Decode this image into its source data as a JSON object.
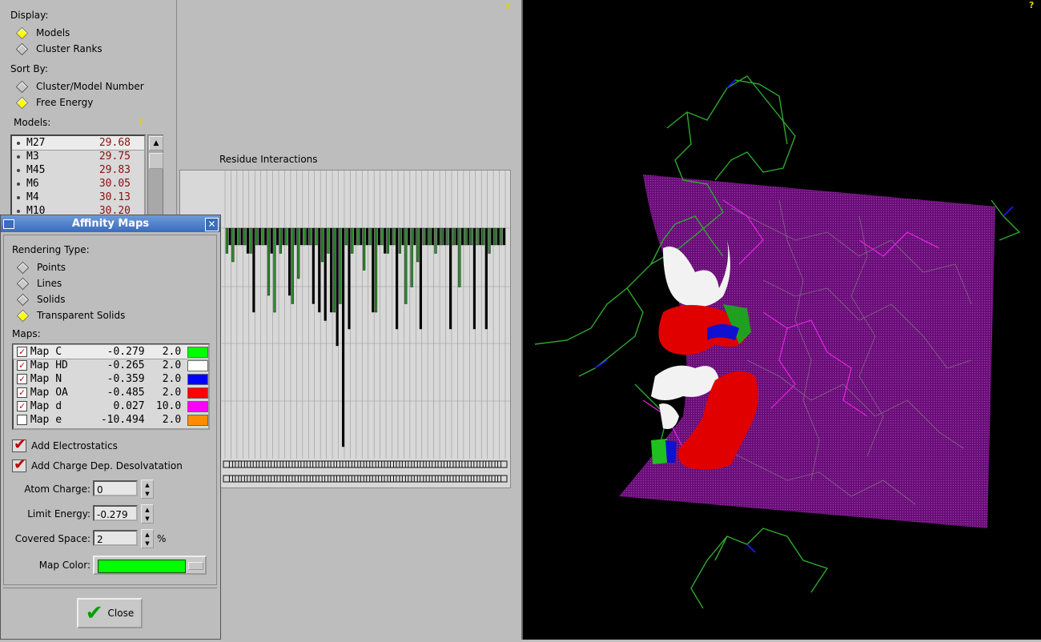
{
  "left_panel": {
    "display_label": "Display:",
    "display_options": [
      {
        "label": "Models",
        "selected": true
      },
      {
        "label": "Cluster Ranks",
        "selected": false
      }
    ],
    "sort_label": "Sort By:",
    "sort_options": [
      {
        "label": "Cluster/Model Number",
        "selected": false
      },
      {
        "label": "Free Energy",
        "selected": true
      }
    ],
    "models_label": "Models:",
    "help": "?",
    "models": [
      {
        "name": "M27",
        "value": "29.68"
      },
      {
        "name": "M3",
        "value": "29.75"
      },
      {
        "name": "M45",
        "value": "29.83"
      },
      {
        "name": "M6",
        "value": "30.05"
      },
      {
        "name": "M4",
        "value": "30.13"
      },
      {
        "name": "M10",
        "value": "30.20"
      }
    ]
  },
  "chart_panel": {
    "help": "?",
    "chart_data": {
      "type": "bar",
      "title": "Residue Interactions",
      "note": "Per-residue interaction bars hanging down from a common baseline; green and black series. Residue tick labels are overlapping and illegible.",
      "series": [
        {
          "color": "#2e8b2e",
          "values": [
            3,
            4,
            2,
            2,
            3,
            2,
            2,
            8,
            10,
            3,
            2,
            9,
            6,
            2,
            2,
            2,
            4,
            3,
            10,
            9,
            2,
            3,
            2,
            5,
            2,
            10,
            2,
            3,
            2,
            3,
            9,
            7,
            4,
            2,
            2,
            3,
            2,
            2,
            2,
            7,
            2,
            2,
            2,
            2,
            3,
            2,
            2
          ]
        },
        {
          "color": "#000000",
          "values": [
            2,
            2,
            2,
            3,
            10,
            2,
            2,
            3,
            2,
            2,
            8,
            2,
            2,
            2,
            9,
            10,
            11,
            10,
            14,
            26,
            12,
            2,
            2,
            2,
            10,
            2,
            3,
            2,
            12,
            2,
            2,
            2,
            12,
            2,
            2,
            2,
            2,
            12,
            2,
            2,
            2,
            12,
            2,
            12,
            2,
            2,
            2
          ]
        }
      ]
    }
  },
  "viewer": {
    "help": "?",
    "surface_colors": {
      "C": "#00ff00",
      "HD": "#ffffff",
      "N": "#0000ff",
      "OA": "#ff0000",
      "d": "#ff00ff",
      "plane": "#6a0f78"
    }
  },
  "dialog": {
    "title": "Affinity Maps",
    "rendering_label": "Rendering Type:",
    "rendering_options": [
      {
        "label": "Points",
        "selected": false
      },
      {
        "label": "Lines",
        "selected": false
      },
      {
        "label": "Solids",
        "selected": false
      },
      {
        "label": "Transparent Solids",
        "selected": true
      }
    ],
    "maps_label": "Maps:",
    "maps": [
      {
        "name": "Map C",
        "energy": "-0.279",
        "scale": "2.0",
        "checked": true,
        "color": "#00ff00"
      },
      {
        "name": "Map HD",
        "energy": "-0.265",
        "scale": "2.0",
        "checked": true,
        "color": "#ffffff"
      },
      {
        "name": "Map N",
        "energy": "-0.359",
        "scale": "2.0",
        "checked": true,
        "color": "#0000ff"
      },
      {
        "name": "Map OA",
        "energy": "-0.485",
        "scale": "2.0",
        "checked": true,
        "color": "#ff0000"
      },
      {
        "name": "Map d",
        "energy": "0.027",
        "scale": "10.0",
        "checked": true,
        "color": "#ff00ff"
      },
      {
        "name": "Map e",
        "energy": "-10.494",
        "scale": "2.0",
        "checked": false,
        "color": "#ff8c00"
      }
    ],
    "add_electrostatics": "Add Electrostatics",
    "add_desolvation": "Add Charge Dep. Desolvatation",
    "atom_charge_label": "Atom Charge:",
    "atom_charge_value": "0",
    "limit_energy_label": "Limit Energy:",
    "limit_energy_value": "-0.279",
    "covered_space_label": "Covered Space:",
    "covered_space_value": "2",
    "covered_space_unit": "%",
    "map_color_label": "Map Color:",
    "map_color": "#00ff00",
    "close_label": "Close"
  }
}
